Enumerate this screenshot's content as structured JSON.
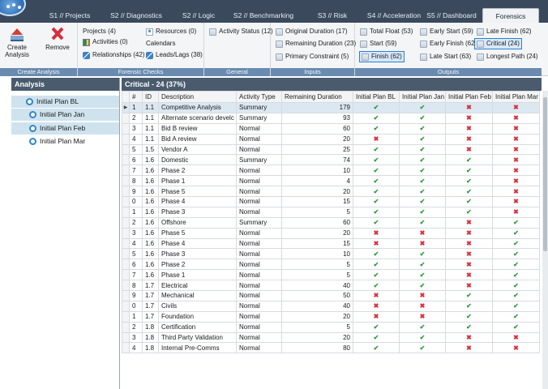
{
  "tabs": [
    {
      "label": "S1 // Projects",
      "active": false
    },
    {
      "label": "S2 // Diagnostics",
      "active": false
    },
    {
      "label": "S2 // Logic",
      "active": false
    },
    {
      "label": "S2 // Benchmarking",
      "active": false
    },
    {
      "label": "S3 // Risk",
      "active": false
    },
    {
      "label": "S4 // Acceleration",
      "active": false
    },
    {
      "label": "S5 // Dashboard",
      "active": false
    },
    {
      "label": "Forensics",
      "active": true
    }
  ],
  "ribbon": {
    "create_group": {
      "name": "Create Analysis",
      "create_label": "Create Analysis",
      "remove_label": "Remove"
    },
    "checks_group": {
      "name": "Forensic Checks",
      "projects": "Projects (4)",
      "activities": "Activities (0)",
      "relationships": "Relationships (42)",
      "resources": "Resources (0)",
      "calendars": "Calendars",
      "leads_lags": "Leads/Lags (38)"
    },
    "general_group": {
      "name": "General",
      "activity_status": "Activity Status (12)"
    },
    "inputs_group": {
      "name": "Inputs",
      "original_duration": "Original Duration (17)",
      "remaining_duration": "Remaining Duration (23)",
      "primary_constraint": "Primary Constraint (5)"
    },
    "outputs_group": {
      "name": "Outputs",
      "total_float": "Total Float (53)",
      "start": "Start (59)",
      "finish": "Finish (62)",
      "early_start": "Early Start (59)",
      "early_finish": "Early Finish (62)",
      "late_start": "Late Start (63)",
      "late_finish": "Late Finish (62)",
      "critical": "Critical (24)",
      "longest_path": "Longest Path (24)"
    }
  },
  "analysis_panel": {
    "title": "Analysis",
    "items": [
      {
        "label": "Initial  Plan BL",
        "selected": true
      },
      {
        "label": "Initial Plan Jan",
        "selected": true
      },
      {
        "label": "Initial Plan Feb",
        "selected": true
      },
      {
        "label": "Initial Plan Mar",
        "selected": false
      }
    ]
  },
  "grid": {
    "title": "Critical - 24 (37%)",
    "columns": [
      "#",
      "ID",
      "Description",
      "Activity Type",
      "Remaining Duration",
      "Initial  Plan BL",
      "Initial Plan Jan",
      "Initial Plan Feb",
      "Initial Plan Mar"
    ],
    "rows": [
      {
        "n": "1",
        "id": "1.1",
        "desc": "Competitive Analysis",
        "type": "Summary",
        "dur": "179",
        "bl": "check",
        "jan": "check",
        "feb": "cross",
        "mar": "cross"
      },
      {
        "n": "2",
        "id": "1.1",
        "desc": "Alternate scenario develc",
        "type": "Summary",
        "dur": "93",
        "bl": "check",
        "jan": "check",
        "feb": "cross",
        "mar": "cross"
      },
      {
        "n": "3",
        "id": "1.1",
        "desc": "Bid B review",
        "type": "Normal",
        "dur": "60",
        "bl": "check",
        "jan": "check",
        "feb": "cross",
        "mar": "cross"
      },
      {
        "n": "4",
        "id": "1.1",
        "desc": "Bid A review",
        "type": "Normal",
        "dur": "20",
        "bl": "cross",
        "jan": "check",
        "feb": "cross",
        "mar": "cross"
      },
      {
        "n": "5",
        "id": "1.5",
        "desc": "Vendor A",
        "type": "Normal",
        "dur": "25",
        "bl": "check",
        "jan": "check",
        "feb": "cross",
        "mar": "cross"
      },
      {
        "n": "6",
        "id": "1.6",
        "desc": "Domestic",
        "type": "Summary",
        "dur": "74",
        "bl": "check",
        "jan": "check",
        "feb": "check",
        "mar": "cross"
      },
      {
        "n": "7",
        "id": "1.6",
        "desc": "Phase 2",
        "type": "Normal",
        "dur": "10",
        "bl": "check",
        "jan": "check",
        "feb": "check",
        "mar": "cross"
      },
      {
        "n": "8",
        "id": "1.6",
        "desc": "Phase 1",
        "type": "Normal",
        "dur": "4",
        "bl": "check",
        "jan": "check",
        "feb": "check",
        "mar": "cross"
      },
      {
        "n": "9",
        "id": "1.6",
        "desc": "Phase 5",
        "type": "Normal",
        "dur": "20",
        "bl": "check",
        "jan": "check",
        "feb": "check",
        "mar": "cross"
      },
      {
        "n": "0",
        "id": "1.6",
        "desc": "Phase 4",
        "type": "Normal",
        "dur": "15",
        "bl": "check",
        "jan": "check",
        "feb": "check",
        "mar": "cross"
      },
      {
        "n": "1",
        "id": "1.6",
        "desc": "Phase 3",
        "type": "Normal",
        "dur": "5",
        "bl": "check",
        "jan": "check",
        "feb": "check",
        "mar": "cross"
      },
      {
        "n": "2",
        "id": "1.6",
        "desc": "Offshore",
        "type": "Summary",
        "dur": "60",
        "bl": "check",
        "jan": "check",
        "feb": "cross",
        "mar": "check"
      },
      {
        "n": "3",
        "id": "1.6",
        "desc": "Phase 5",
        "type": "Normal",
        "dur": "20",
        "bl": "cross",
        "jan": "cross",
        "feb": "cross",
        "mar": "check"
      },
      {
        "n": "4",
        "id": "1.6",
        "desc": "Phase 4",
        "type": "Normal",
        "dur": "15",
        "bl": "cross",
        "jan": "cross",
        "feb": "cross",
        "mar": "check"
      },
      {
        "n": "5",
        "id": "1.6",
        "desc": "Phase 3",
        "type": "Normal",
        "dur": "10",
        "bl": "check",
        "jan": "check",
        "feb": "cross",
        "mar": "check"
      },
      {
        "n": "6",
        "id": "1.6",
        "desc": "Phase 2",
        "type": "Normal",
        "dur": "5",
        "bl": "check",
        "jan": "check",
        "feb": "cross",
        "mar": "check"
      },
      {
        "n": "7",
        "id": "1.6",
        "desc": "Phase 1",
        "type": "Normal",
        "dur": "5",
        "bl": "check",
        "jan": "check",
        "feb": "cross",
        "mar": "check"
      },
      {
        "n": "8",
        "id": "1.7",
        "desc": "Electrical",
        "type": "Normal",
        "dur": "40",
        "bl": "check",
        "jan": "check",
        "feb": "cross",
        "mar": "check"
      },
      {
        "n": "9",
        "id": "1.7",
        "desc": "Mechanical",
        "type": "Normal",
        "dur": "50",
        "bl": "cross",
        "jan": "cross",
        "feb": "check",
        "mar": "check"
      },
      {
        "n": "0",
        "id": "1.7",
        "desc": "Civils",
        "type": "Normal",
        "dur": "40",
        "bl": "cross",
        "jan": "cross",
        "feb": "check",
        "mar": "check"
      },
      {
        "n": "1",
        "id": "1.7",
        "desc": "Foundation",
        "type": "Normal",
        "dur": "20",
        "bl": "cross",
        "jan": "cross",
        "feb": "check",
        "mar": "check"
      },
      {
        "n": "2",
        "id": "1.8",
        "desc": "Certification",
        "type": "Normal",
        "dur": "5",
        "bl": "check",
        "jan": "check",
        "feb": "check",
        "mar": "check"
      },
      {
        "n": "3",
        "id": "1.8",
        "desc": "Third Party Validation",
        "type": "Normal",
        "dur": "20",
        "bl": "check",
        "jan": "check",
        "feb": "cross",
        "mar": "cross"
      },
      {
        "n": "4",
        "id": "1.8",
        "desc": "Internal Pre-Comms",
        "type": "Normal",
        "dur": "80",
        "bl": "check",
        "jan": "check",
        "feb": "cross",
        "mar": "cross"
      }
    ]
  },
  "symbols": {
    "check": "✔",
    "cross": "✖"
  },
  "colors": {
    "header_bg": "#4a5b6e",
    "tabbar_bg": "#3a4a5c",
    "check": "#2e9a3d",
    "cross": "#d6303a",
    "group_label_bg": "#6a8bb0"
  }
}
